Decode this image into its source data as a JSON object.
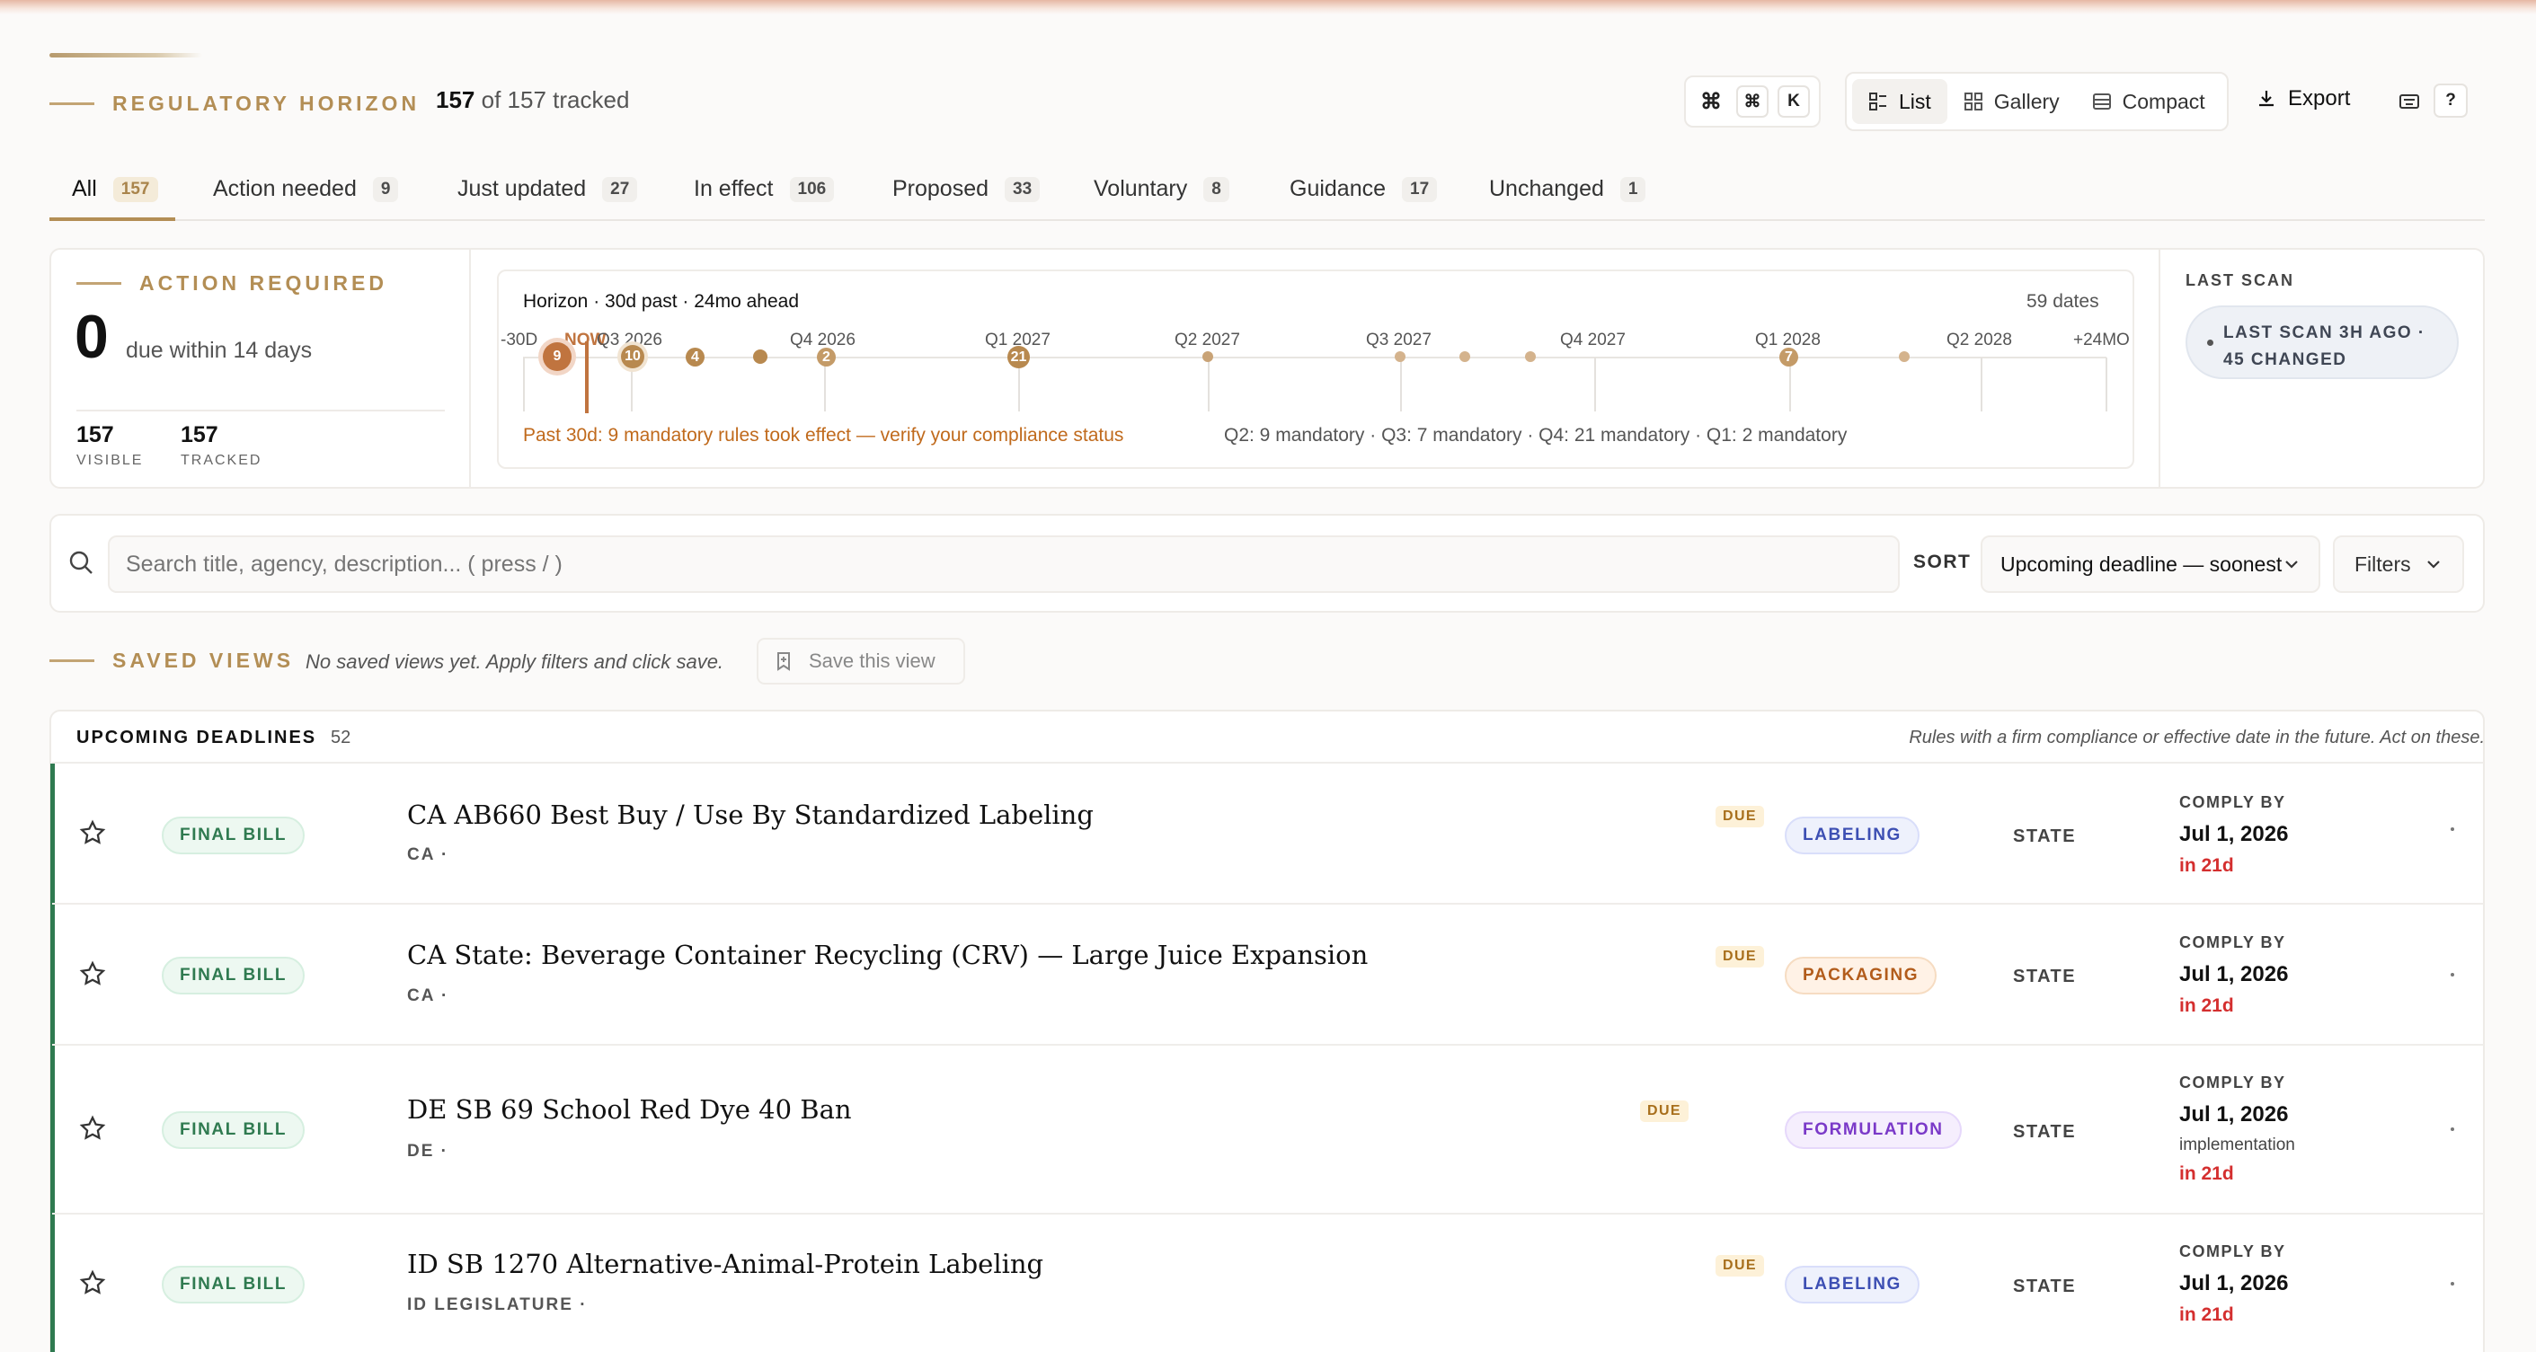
{
  "header": {
    "title": "REGULATORY HORIZON",
    "count_visible": "157",
    "count_rest": "of 157 tracked",
    "shortcut_keys": [
      "⌘",
      "⌘",
      "K"
    ],
    "views": [
      {
        "label": "List",
        "icon": "list-icon",
        "active": true
      },
      {
        "label": "Gallery",
        "icon": "grid-icon",
        "active": false
      },
      {
        "label": "Compact",
        "icon": "compact-icon",
        "active": false
      }
    ],
    "export_label": "Export",
    "help_label": "?"
  },
  "tabs": [
    {
      "label": "All",
      "count": "157",
      "active": true
    },
    {
      "label": "Action needed",
      "count": "9"
    },
    {
      "label": "Just updated",
      "count": "27"
    },
    {
      "label": "In effect",
      "count": "106"
    },
    {
      "label": "Proposed",
      "count": "33"
    },
    {
      "label": "Voluntary",
      "count": "8"
    },
    {
      "label": "Guidance",
      "count": "17"
    },
    {
      "label": "Unchanged",
      "count": "1"
    }
  ],
  "action": {
    "eyebrow": "ACTION REQUIRED",
    "big_number": "0",
    "due_text": "due within 14 days",
    "visible_num": "157",
    "visible_label": "VISIBLE",
    "tracked_num": "157",
    "tracked_label": "TRACKED"
  },
  "horizon": {
    "title": "Horizon · 30d past · 24mo ahead",
    "dates_count": "59 dates",
    "axis_labels": [
      "-30D",
      "NOW",
      "Q3 2026",
      "Q4 2026",
      "Q1 2027",
      "Q2 2027",
      "Q3 2027",
      "Q4 2027",
      "Q1 2028",
      "Q2 2028",
      "+24MO"
    ],
    "badges": [
      "9",
      "10",
      "4",
      "2",
      "21",
      "7"
    ],
    "warning": "Past 30d: 9 mandatory rules took effect — verify your compliance status",
    "summary": "Q2: 9 mandatory · Q3: 7 mandatory · Q4: 21 mandatory · Q1: 2 mandatory",
    "accent": "#c0743f"
  },
  "last_scan": {
    "label": "LAST SCAN",
    "pill_line1": "LAST SCAN 3H AGO ·",
    "pill_line2": "45 CHANGED"
  },
  "search": {
    "placeholder": "Search title, agency, description... ( press / )",
    "sort_label": "SORT",
    "sort_value": "Upcoming deadline — soonest",
    "filters_label": "Filters"
  },
  "saved_views": {
    "eyebrow": "SAVED VIEWS",
    "empty_text": "No saved views yet. Apply filters and click save.",
    "save_label": "Save this view"
  },
  "deadlines": {
    "heading": "UPCOMING DEADLINES",
    "count": "52",
    "note": "Rules with a firm compliance or effective date in the future. Act on these.",
    "rows": [
      {
        "status": "FINAL BILL",
        "title": "CA AB660 Best Buy / Use By Standardized Labeling",
        "sub": "CA ·",
        "due": "DUE",
        "category": "LABELING",
        "cat_class": "labeling",
        "scope": "STATE",
        "comply_label": "COMPLY BY",
        "date": "Jul 1, 2026",
        "extra": "",
        "in": "in 21d"
      },
      {
        "status": "FINAL BILL",
        "title": "CA State: Beverage Container Recycling (CRV) — Large Juice Expansion",
        "sub": "CA ·",
        "due": "DUE",
        "category": "PACKAGING",
        "cat_class": "packaging",
        "scope": "STATE",
        "comply_label": "COMPLY BY",
        "date": "Jul 1, 2026",
        "extra": "",
        "in": "in 21d"
      },
      {
        "status": "FINAL BILL",
        "title": "DE SB 69 School Red Dye 40 Ban",
        "sub": "DE ·",
        "due": "DUE",
        "category": "FORMULATION",
        "cat_class": "formulation",
        "scope": "STATE",
        "comply_label": "COMPLY BY",
        "date": "Jul 1, 2026",
        "extra": "implementation",
        "in": "in 21d"
      },
      {
        "status": "FINAL BILL",
        "title": "ID SB 1270 Alternative-Animal-Protein Labeling",
        "sub": "ID LEGISLATURE ·",
        "due": "DUE",
        "category": "LABELING",
        "cat_class": "labeling",
        "scope": "STATE",
        "comply_label": "COMPLY BY",
        "date": "Jul 1, 2026",
        "extra": "",
        "in": "in 21d"
      }
    ]
  }
}
